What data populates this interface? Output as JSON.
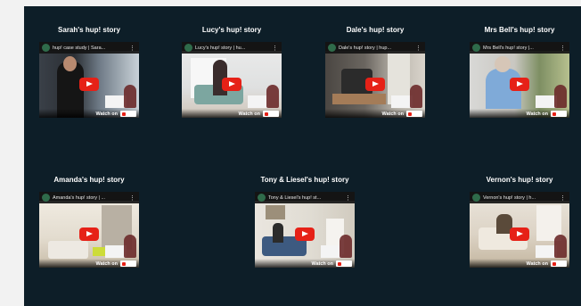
{
  "cards": [
    {
      "title": "Sarah's hup! story",
      "video_title": "hup! case study | Sara...",
      "watch_label": "Watch on",
      "scene": "s1"
    },
    {
      "title": "Lucy's hup! story",
      "video_title": "Lucy's hup! story | hu...",
      "watch_label": "Watch on",
      "scene": "s2"
    },
    {
      "title": "Dale's hup! story",
      "video_title": "Dale's hup! story | hup...",
      "watch_label": "Watch on",
      "scene": "s3"
    },
    {
      "title": "Mrs Bell's hup! story",
      "video_title": "Mrs Bell's hup! story |...",
      "watch_label": "Watch on",
      "scene": "s4"
    },
    {
      "title": "Amanda's hup! story",
      "video_title": "Amanda's hup! story | ...",
      "watch_label": "Watch on",
      "scene": "s5"
    },
    {
      "title": "Tony & Liesel's hup! story",
      "video_title": "Tony & Liesel's hup! st...",
      "watch_label": "Watch on",
      "scene": "s6"
    },
    {
      "title": "Vernon's hup! story",
      "video_title": "Vernon's hup! story | h...",
      "watch_label": "Watch on",
      "scene": "s7"
    }
  ],
  "icons": {
    "play": "youtube-play-icon",
    "menu": "kebab-menu-icon",
    "logo": "youtube-logo-icon"
  },
  "colors": {
    "panel_bg": "#0d1e28",
    "play_red": "#e62117"
  }
}
